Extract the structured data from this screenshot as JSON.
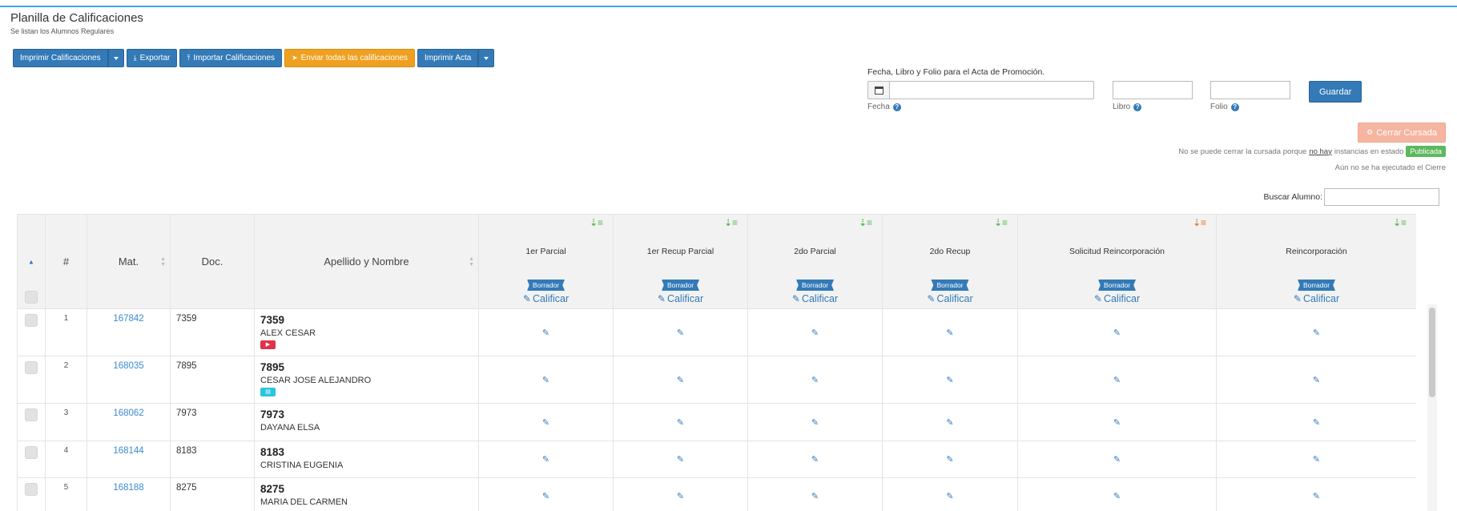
{
  "header": {
    "title": "Planilla de Calificaciones",
    "subtitle": "Se listan los Alumnos Regulares"
  },
  "toolbar": {
    "imprimir_calificaciones": "Imprimir Calificaciones",
    "exportar": "Exportar",
    "importar": "Importar Calificaciones",
    "enviar_todas": "Enviar todas las calificaciones",
    "imprimir_acta": "Imprimir Acta"
  },
  "acta": {
    "title": "Fecha, Libro y Folio para el Acta de Promoción.",
    "fecha_label": "Fecha",
    "libro_label": "Libro",
    "folio_label": "Folio",
    "fecha_value": "",
    "libro_value": "",
    "folio_value": "",
    "guardar": "Guardar"
  },
  "cierre": {
    "button": "Cerrar Cursada",
    "notice_prefix": "No se puede cerrar la cursada porque",
    "notice_link": "no hay",
    "notice_suffix": "instancias en estado",
    "badge": "Publicada",
    "status": "Aún no se ha ejecutado el Cierre"
  },
  "search": {
    "label": "Buscar Alumno:",
    "value": ""
  },
  "table": {
    "headers": {
      "num": "#",
      "mat": "Mat.",
      "doc": "Doc.",
      "nombre": "Apellido y Nombre"
    },
    "columns": [
      {
        "title": "1er Parcial",
        "status": "Borrador",
        "action": "Calificar",
        "sort_color": "#5cb85c"
      },
      {
        "title": "1er Recup Parcial",
        "status": "Borrador",
        "action": "Calificar",
        "sort_color": "#5cb85c"
      },
      {
        "title": "2do Parcial",
        "status": "Borrador",
        "action": "Calificar",
        "sort_color": "#5cb85c"
      },
      {
        "title": "2do Recup",
        "status": "Borrador",
        "action": "Calificar",
        "sort_color": "#5cb85c"
      },
      {
        "title": "Solicitud Reincorporación",
        "status": "Borrador",
        "action": "Calificar",
        "sort_color": "#e8772e"
      },
      {
        "title": "Reincorporación",
        "status": "Borrador",
        "action": "Calificar",
        "sort_color": "#5cb85c"
      }
    ],
    "rows": [
      {
        "num": "1",
        "mat": "167842",
        "doc": "7359",
        "name_doc": "7359",
        "name": "ALEX CESAR",
        "tag": "red"
      },
      {
        "num": "2",
        "mat": "168035",
        "doc": "7895",
        "name_doc": "7895",
        "name": "CESAR JOSE ALEJANDRO",
        "tag": "cyan"
      },
      {
        "num": "3",
        "mat": "168062",
        "doc": "7973",
        "name_doc": "7973",
        "name": "DAYANA ELSA",
        "tag": ""
      },
      {
        "num": "4",
        "mat": "168144",
        "doc": "8183",
        "name_doc": "8183",
        "name": "CRISTINA EUGENIA",
        "tag": ""
      },
      {
        "num": "5",
        "mat": "168188",
        "doc": "8275",
        "name_doc": "8275",
        "name": "MARIA DEL CARMEN",
        "tag": ""
      }
    ]
  },
  "colors": {
    "primary": "#337ab7",
    "warning": "#f0a020",
    "success": "#5cb85c",
    "danger_light": "#f5b5a0"
  }
}
